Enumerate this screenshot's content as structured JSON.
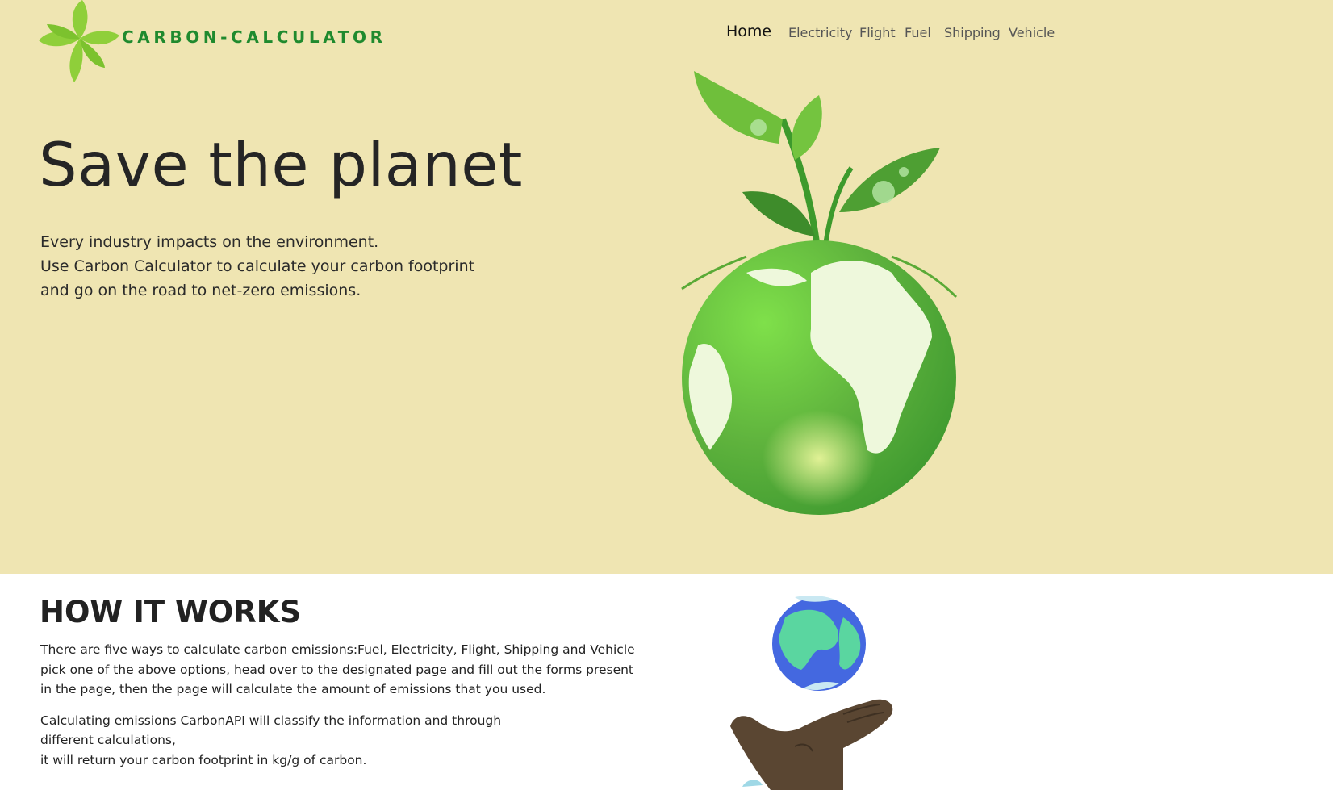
{
  "header": {
    "brand": "CARBON-CALCULATOR",
    "nav": [
      {
        "label": "Home",
        "active": true
      },
      {
        "label": "Electricity"
      },
      {
        "label": "Flight"
      },
      {
        "label": "Fuel"
      },
      {
        "label": "Shipping"
      },
      {
        "label": "Vehicle"
      }
    ]
  },
  "hero": {
    "title": "Save the planet",
    "lines": [
      "Every industry impacts on the environment.",
      "Use Carbon Calculator to calculate your carbon footprint",
      "and go on the road to net-zero emissions."
    ]
  },
  "how": {
    "title": "HOW IT WORKS",
    "para1": [
      "There are five ways to calculate carbon emissions:Fuel, Electricity, Flight, Shipping and Vehicle",
      "pick one of the above options, head over to the designated page and fill out the forms present",
      "in the page, then the page will calculate the amount of emissions that you used."
    ],
    "para2": [
      "Calculating emissions CarbonAPI will classify the information and through",
      "different calculations,",
      "it will return your carbon footprint in kg/g of carbon."
    ]
  },
  "colors": {
    "hero_bg": "#efe5b2",
    "brand": "#1f8a2e",
    "leaf": "#8fcf3a",
    "globe": "#5fb33d"
  },
  "icons": {
    "logo": "leaf-flower-icon",
    "hero_image": "plant-globe-illustration",
    "how_image": "hand-holding-earth-illustration"
  }
}
